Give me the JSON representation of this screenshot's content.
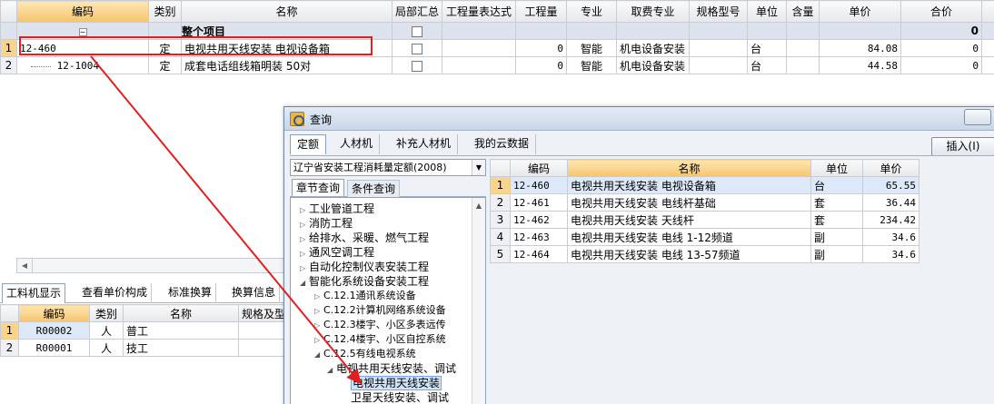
{
  "top_grid": {
    "headers": [
      "",
      "编码",
      "类别",
      "名称",
      "局部汇总",
      "工程量表达式",
      "工程量",
      "专业",
      "取费专业",
      "规格型号",
      "单位",
      "含量",
      "单价",
      "合价"
    ],
    "group_row": {
      "name": "整个项目",
      "total": "0"
    },
    "rows": [
      {
        "num": "1",
        "code": "12-460",
        "type": "定",
        "name": "电视共用天线安装 电视设备箱",
        "qty": "0",
        "major": "智能",
        "fee_major": "机电设备安装",
        "unit": "台",
        "price": "84.08",
        "total": "0"
      },
      {
        "num": "2",
        "code": "12-1004",
        "type": "定",
        "name": "成套电话组线箱明装 50对",
        "qty": "0",
        "major": "智能",
        "fee_major": "机电设备安装",
        "unit": "台",
        "price": "44.58",
        "total": "0"
      }
    ]
  },
  "bottom_panel": {
    "tabs": [
      "工料机显示",
      "查看单价构成",
      "标准换算",
      "换算信息"
    ],
    "headers": [
      "",
      "编码",
      "类别",
      "名称",
      "规格及型"
    ],
    "rows": [
      {
        "num": "1",
        "code": "R00002",
        "type": "人",
        "name": "普工"
      },
      {
        "num": "2",
        "code": "R00001",
        "type": "人",
        "name": "技工"
      }
    ]
  },
  "dialog": {
    "title": "查询",
    "tabs": [
      "定额",
      "人材机",
      "补充人材机",
      "我的云数据"
    ],
    "insert_label": "插入(I)",
    "combo_value": "辽宁省安装工程消耗量定额(2008)",
    "subtabs": [
      "章节查询",
      "条件查询"
    ],
    "tree": [
      {
        "label": "工业管道工程"
      },
      {
        "label": "消防工程"
      },
      {
        "label": "给排水、采暖、燃气工程"
      },
      {
        "label": "通风空调工程"
      },
      {
        "label": "自动化控制仪表安装工程"
      },
      {
        "label": "智能化系统设备安装工程"
      },
      {
        "label": "C.12.1通讯系统设备"
      },
      {
        "label": "C.12.2计算机网络系统设备"
      },
      {
        "label": "C.12.3楼宇、小区多表远传"
      },
      {
        "label": "C.12.4楼宇、小区自控系统"
      },
      {
        "label": "C.12.5有线电视系统"
      },
      {
        "label": "电视共用天线安装、调试"
      },
      {
        "label": "电视共用天线安装"
      },
      {
        "label": "卫星天线安装、调试"
      }
    ],
    "result_headers": [
      "",
      "编码",
      "名称",
      "单位",
      "单价"
    ],
    "results": [
      {
        "num": "1",
        "code": "12-460",
        "name": "电视共用天线安装 电视设备箱",
        "unit": "台",
        "price": "65.55"
      },
      {
        "num": "2",
        "code": "12-461",
        "name": "电视共用天线安装 电线杆基础",
        "unit": "套",
        "price": "36.44"
      },
      {
        "num": "3",
        "code": "12-462",
        "name": "电视共用天线安装 天线杆",
        "unit": "套",
        "price": "234.42"
      },
      {
        "num": "4",
        "code": "12-463",
        "name": "电视共用天线安装 电线 1-12频道",
        "unit": "副",
        "price": "34.6"
      },
      {
        "num": "5",
        "code": "12-464",
        "name": "电视共用天线安装 电线 13-57频道",
        "unit": "副",
        "price": "34.6"
      }
    ]
  },
  "colors": {
    "highlight_box": "#e02020",
    "header_highlight": "#f7c46b",
    "selection": "#cfe3fb"
  }
}
